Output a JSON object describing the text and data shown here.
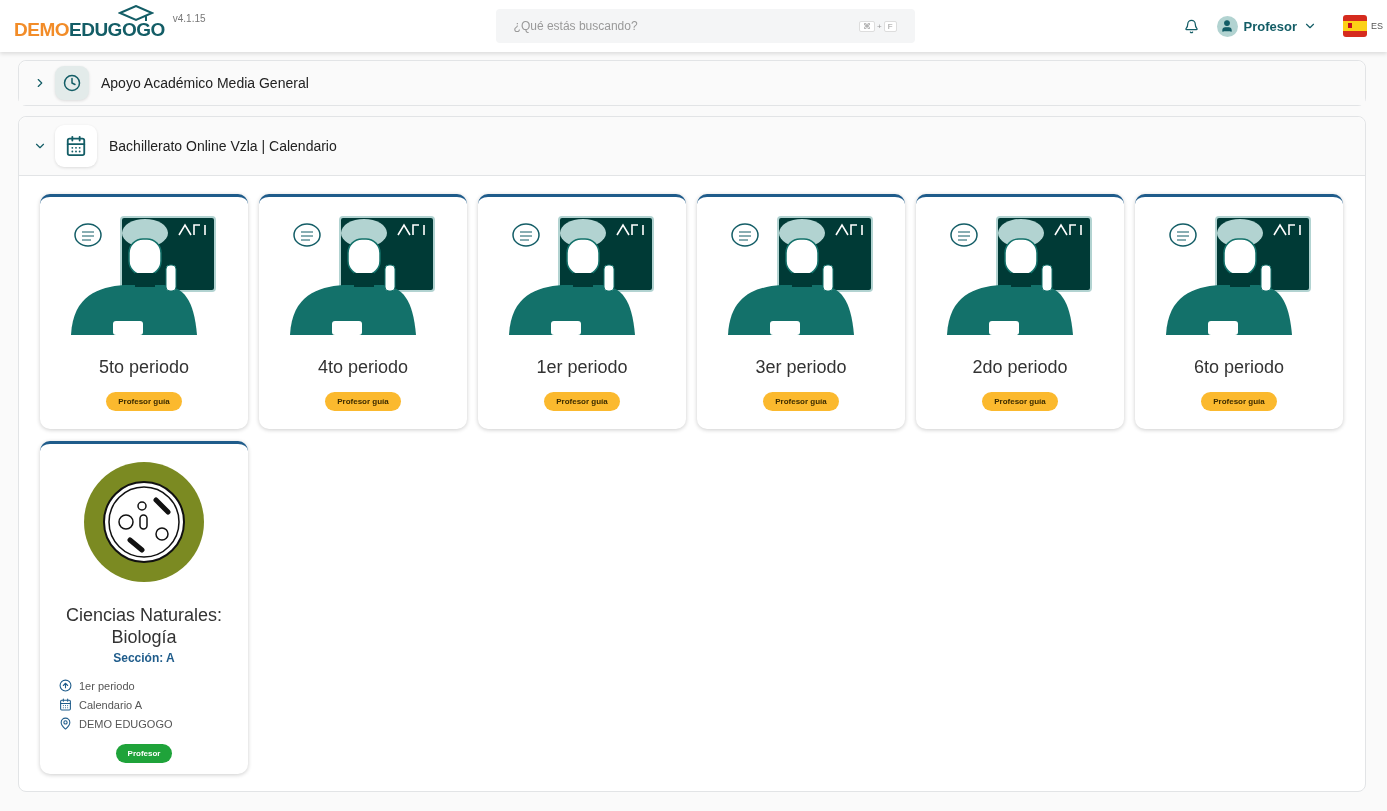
{
  "header": {
    "logo_left": "DEMO",
    "logo_right": "EDUGOGO",
    "version": "v4.1.15",
    "search": {
      "placeholder": "¿Qué estás buscando?",
      "shortcut": [
        "⌘",
        "+",
        "F"
      ]
    },
    "user": "Profesor",
    "language": "ES"
  },
  "sections": [
    {
      "title": "Apoyo Académico Media General",
      "expanded": false
    },
    {
      "title": "Bachillerato Online Vzla | Calendario",
      "expanded": true,
      "cards": [
        {
          "kind": "period",
          "title": "5to periodo",
          "badge": "Profesor guía"
        },
        {
          "kind": "period",
          "title": "4to periodo",
          "badge": "Profesor guía"
        },
        {
          "kind": "period",
          "title": "1er periodo",
          "badge": "Profesor guía"
        },
        {
          "kind": "period",
          "title": "3er periodo",
          "badge": "Profesor guía"
        },
        {
          "kind": "period",
          "title": "2do periodo",
          "badge": "Profesor guía"
        },
        {
          "kind": "period",
          "title": "6to periodo",
          "badge": "Profesor guía"
        },
        {
          "kind": "course",
          "title": "Ciencias Naturales: Biología",
          "section": "Sección: A",
          "period": "1er periodo",
          "calendar": "Calendario A",
          "school": "DEMO EDUGOGO",
          "badge": "Profesor"
        }
      ]
    }
  ]
}
